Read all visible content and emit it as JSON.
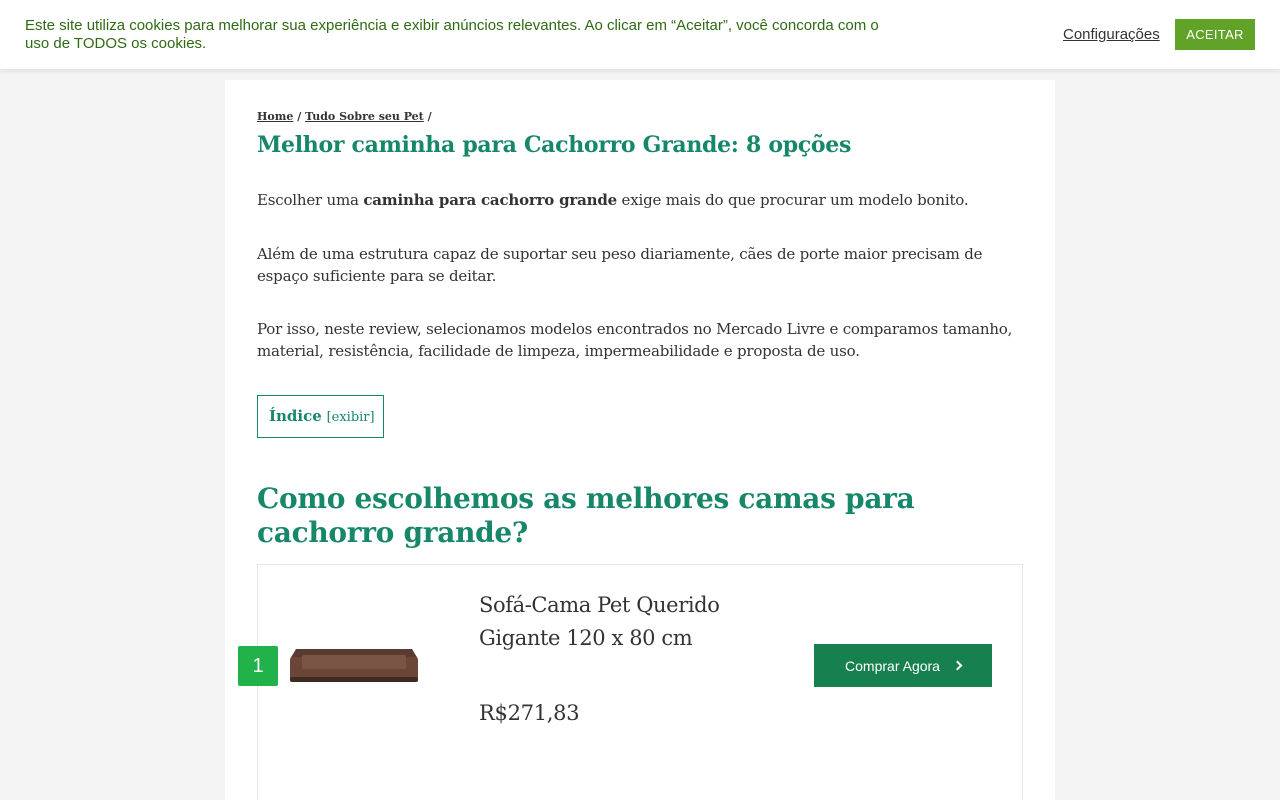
{
  "cookie_banner": {
    "text": "Este site utiliza cookies para melhorar sua experiência e exibir anúncios relevantes. Ao clicar em “Aceitar”, você concorda com o uso de TODOS os cookies.",
    "settings_label": "Configurações",
    "accept_label": "ACEITAR"
  },
  "breadcrumb": {
    "home": "Home",
    "sep1": " / ",
    "category": "Tudo Sobre seu Pet",
    "sep2": " /"
  },
  "page_title": "Melhor caminha para Cachorro Grande: 8 opções",
  "intro": {
    "p1_before": "Escolher uma ",
    "p1_bold": "caminha para cachorro grande",
    "p1_after": " exige mais do que procurar um modelo bonito.",
    "p2": "Além de uma estrutura capaz de suportar seu peso diariamente, cães de porte maior precisam de espaço suficiente para se deitar.",
    "p3": "Por isso, neste review, selecionamos modelos encontrados no Mercado Livre e comparamos tamanho, material, resistência, facilidade de limpeza, impermeabilidade e proposta de uso."
  },
  "toc": {
    "title": "Índice",
    "toggle": "[exibir]"
  },
  "section_title": "Como escolhemos as melhores camas para cachorro grande?",
  "products": [
    {
      "rank": "1",
      "name": "Sofá-Cama Pet Querido Gigante 120 x 80 cm",
      "price": "R$271,83",
      "button_label": "Comprar Agora",
      "button_icon": "chevron-right-icon"
    }
  ],
  "colors": {
    "accent_green": "#17876a",
    "button_green": "#17804f",
    "badge_green": "#21b34a",
    "accept_green": "#61a229",
    "cookie_text": "#2e6b13"
  }
}
